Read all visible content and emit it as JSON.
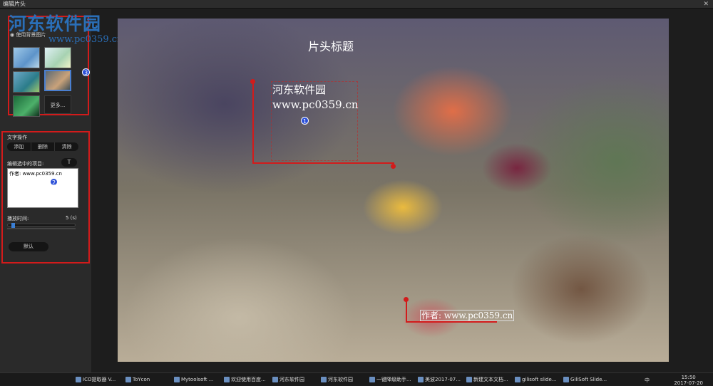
{
  "window": {
    "title": "编辑片头",
    "close_glyph": "✕"
  },
  "watermark": {
    "text": "河东软件园",
    "url": "www.pc0359.cn"
  },
  "sidebar": {
    "radio_label": "使用背景图片",
    "more_label": "更多...",
    "text_section_label": "文字操作",
    "text_buttons": [
      "添加",
      "删除",
      "清除"
    ],
    "edit_label": "编辑选中的项目:",
    "text_tool_label": "T",
    "textarea_value": "作者: www.pc0359.cn",
    "duration_label": "播放时间:",
    "duration_value": "5 (s)",
    "slider_level": 0.05,
    "ok_label": "默认",
    "badges": [
      "1",
      "2",
      "3"
    ]
  },
  "preview": {
    "title": "片头标题",
    "text_line1": "河东软件园",
    "text_line2": "www.pc0359.cn",
    "author": "作者: www.pc0359.cn"
  },
  "taskbar": {
    "items": [
      "ICO提取器 V...",
      "ToYcon",
      "Mytoolsoft ...",
      "欢迎使用百度...",
      "河东软件园",
      "河东软件园",
      "一键降级助手...",
      "美波2017-07...",
      "新建文本文档...",
      "gilisoft slide...",
      "GiliSoft Slide..."
    ],
    "time": "15:50",
    "date": "2017-07-20",
    "ime": "中"
  },
  "colors": {
    "accent_red": "#d21b1b",
    "badge_blue": "#2b4fd8",
    "watermark_blue": "#2a6fb8"
  }
}
